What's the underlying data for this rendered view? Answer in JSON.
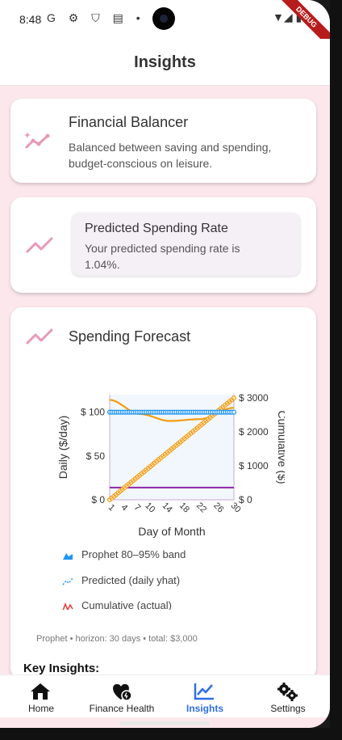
{
  "status": {
    "time": "8:48",
    "icons": "G ⚙ ⛉ ▤ •",
    "debug": "DEBUG"
  },
  "app": {
    "title": "Insights"
  },
  "card_balancer": {
    "title": "Financial Balancer",
    "desc_line1": "Balanced between saving and spending,",
    "desc_line2": "budget-conscious on leisure.",
    "icon": "sparkline-icon"
  },
  "card_rate": {
    "title": "Predicted Spending Rate",
    "desc_line1": "Your predicted spending rate is",
    "desc_line2": "1.04%.",
    "icon": "trend-icon"
  },
  "card_forecast": {
    "title": "Spending Forecast",
    "icon": "trend-icon",
    "legend": [
      "Prophet 80–95% band",
      "Predicted (daily yhat)",
      "Cumulative (actual)"
    ],
    "caption": "Prophet • horizon: 30 days • total: $3,000",
    "key_insights": "Key Insights:"
  },
  "colors": {
    "accent_pink": "#e79ab2",
    "blue": "#2196f3",
    "orange": "#f39c12",
    "purple": "#8e24aa",
    "active_nav": "#2f6fe4"
  },
  "chart_data": {
    "type": "line",
    "xlabel": "Day of Month",
    "ylabel_left": "Daily ($/day)",
    "ylabel_right": "Cumulative ($)",
    "x_ticks": [
      "1",
      "4",
      "7",
      "10",
      "14",
      "18",
      "22",
      "26",
      "30"
    ],
    "y_left_ticks": [
      "$ 0",
      "$ 50",
      "$ 100"
    ],
    "y_right_ticks": [
      "$ 0",
      "$ 1000",
      "$ 2000",
      "$ 3000"
    ],
    "ylim_left": [
      0,
      120
    ],
    "ylim_right": [
      0,
      3100
    ],
    "xlim": [
      1,
      30
    ],
    "series": [
      {
        "name": "Predicted (daily yhat)",
        "axis": "left",
        "color": "#2196f3",
        "x_start": 1,
        "x_end": 30,
        "values_const": 100
      },
      {
        "name": "Cumulative (actual)",
        "axis": "right",
        "color": "#f39c12",
        "x_start": 1,
        "x_end": 30,
        "y_start": 0,
        "y_end": 3000
      },
      {
        "axis": "left",
        "color": "#f39c12",
        "x": [
          1,
          8,
          15,
          22,
          30
        ],
        "y": [
          114,
          98,
          90,
          92,
          105
        ]
      },
      {
        "axis": "left",
        "color": "#8e24aa",
        "x": [
          1,
          30
        ],
        "y": [
          14,
          14
        ]
      }
    ]
  },
  "nav": [
    {
      "label": "Home",
      "icon": "home-icon"
    },
    {
      "label": "Finance Health",
      "icon": "heart-health-icon"
    },
    {
      "label": "Insights",
      "icon": "chart-icon"
    },
    {
      "label": "Settings",
      "icon": "gears-icon"
    }
  ]
}
